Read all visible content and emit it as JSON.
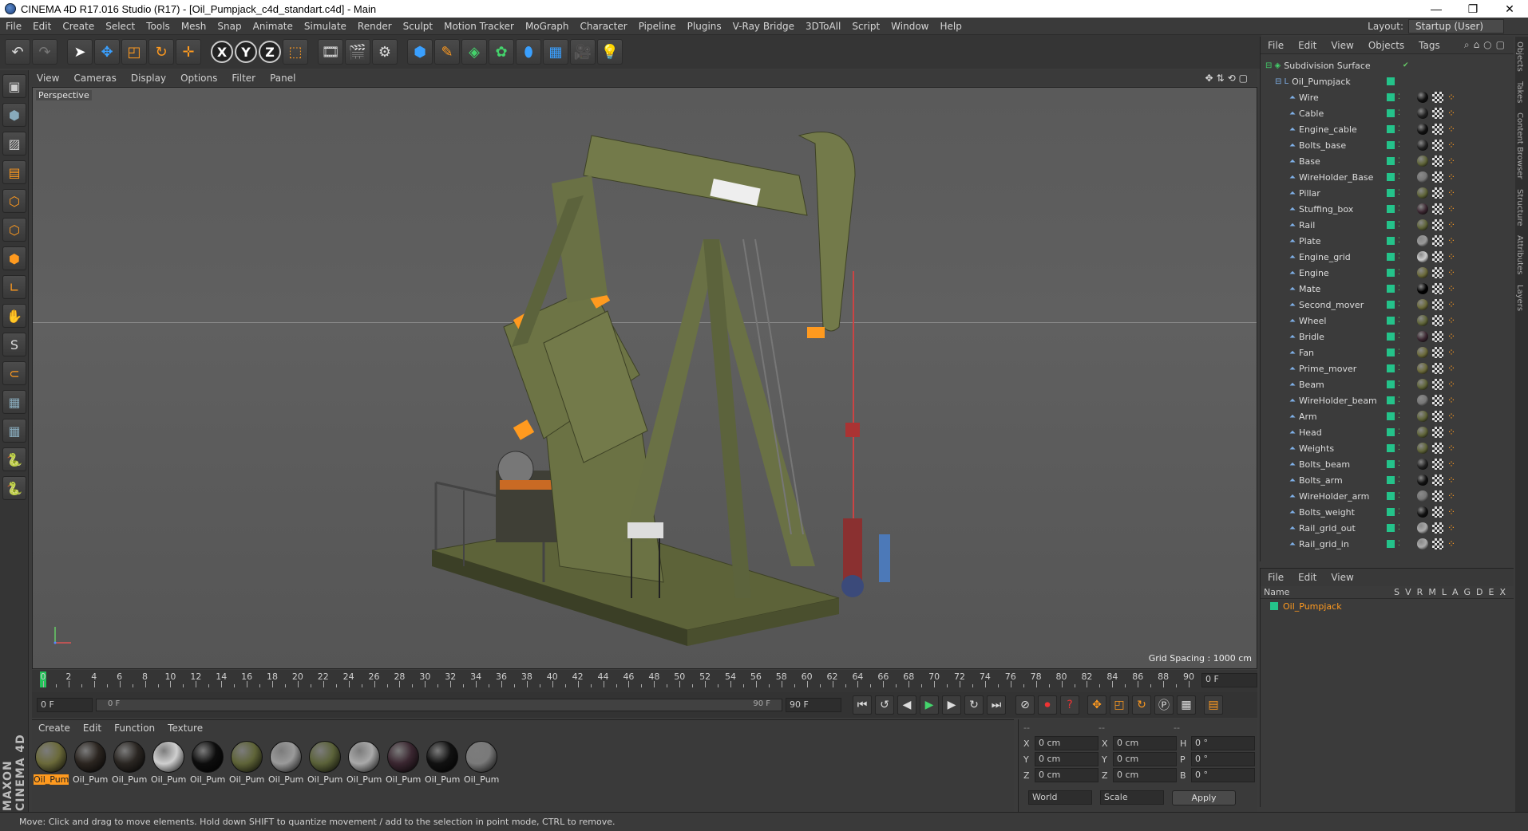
{
  "window": {
    "title": "CINEMA 4D R17.016 Studio (R17) - [Oil_Pumpjack_c4d_standart.c4d] - Main",
    "minimize": "—",
    "restore": "❐",
    "close": "✕"
  },
  "menubar": {
    "items": [
      "File",
      "Edit",
      "Create",
      "Select",
      "Tools",
      "Mesh",
      "Snap",
      "Animate",
      "Simulate",
      "Render",
      "Sculpt",
      "Motion Tracker",
      "MoGraph",
      "Character",
      "Pipeline",
      "Plugins",
      "V-Ray Bridge",
      "3DToAll",
      "Script",
      "Window",
      "Help"
    ],
    "layout_label": "Layout:",
    "layout_value": "Startup (User)"
  },
  "toolbar": {
    "icons": [
      "undo-icon",
      "redo-icon",
      "select-icon",
      "move-icon",
      "scale-icon",
      "rotate-icon",
      "live-select-icon",
      "x-axis-icon",
      "y-axis-icon",
      "z-axis-icon",
      "coordinate-system-icon",
      "render-view-icon",
      "render-picture-icon",
      "render-settings-icon",
      "cube-icon",
      "pen-icon",
      "subdivision-icon",
      "array-icon",
      "deformer-icon",
      "floor-icon",
      "camera-icon",
      "light-icon"
    ],
    "x": "X",
    "y": "Y",
    "z": "Z"
  },
  "viewport": {
    "menu": [
      "View",
      "Cameras",
      "Display",
      "Options",
      "Filter",
      "Panel"
    ],
    "label": "Perspective",
    "grid_spacing": "Grid Spacing : 1000 cm"
  },
  "timeline": {
    "ticks": [
      "0",
      "2",
      "4",
      "6",
      "8",
      "10",
      "12",
      "14",
      "16",
      "18",
      "20",
      "22",
      "24",
      "26",
      "28",
      "30",
      "32",
      "34",
      "36",
      "38",
      "40",
      "42",
      "44",
      "46",
      "48",
      "50",
      "52",
      "54",
      "56",
      "58",
      "60",
      "62",
      "64",
      "66",
      "68",
      "70",
      "72",
      "74",
      "76",
      "78",
      "80",
      "82",
      "84",
      "86",
      "88",
      "90"
    ],
    "current_frame": "0 F",
    "start_field": "0 F",
    "slider_start": "0 F",
    "slider_end": "90 F",
    "end_field": "90 F"
  },
  "materials": {
    "menu": [
      "Create",
      "Edit",
      "Function",
      "Texture"
    ],
    "items": [
      {
        "label": "Oil_Pum",
        "color": "#6b6a3a",
        "selected": true
      },
      {
        "label": "Oil_Pum",
        "color": "#2b2520"
      },
      {
        "label": "Oil_Pum",
        "color": "#2a2622"
      },
      {
        "label": "Oil_Pum",
        "color": "#cfcfcf"
      },
      {
        "label": "Oil_Pum",
        "color": "#0d0d0d"
      },
      {
        "label": "Oil_Pum",
        "color": "#5f6438"
      },
      {
        "label": "Oil_Pum",
        "color": "#9a9a9a"
      },
      {
        "label": "Oil_Pum",
        "color": "#5b6239"
      },
      {
        "label": "Oil_Pum",
        "color": "#a9a9a9"
      },
      {
        "label": "Oil_Pum",
        "color": "#3a2630"
      },
      {
        "label": "Oil_Pum",
        "color": "#111111"
      },
      {
        "label": "Oil_Pum",
        "color": "#7a7a7a"
      }
    ]
  },
  "coords": {
    "header": [
      "--",
      "--",
      "--"
    ],
    "rows": [
      {
        "a": "X",
        "av": "0 cm",
        "b": "X",
        "bv": "0 cm",
        "c": "H",
        "cv": "0 °"
      },
      {
        "a": "Y",
        "av": "0 cm",
        "b": "Y",
        "bv": "0 cm",
        "c": "P",
        "cv": "0 °"
      },
      {
        "a": "Z",
        "av": "0 cm",
        "b": "Z",
        "bv": "0 cm",
        "c": "B",
        "cv": "0 °"
      }
    ],
    "world": "World",
    "scale": "Scale",
    "apply": "Apply"
  },
  "objects": {
    "menu": [
      "File",
      "Edit",
      "View",
      "Objects",
      "Tags"
    ],
    "root": "Subdivision Surface",
    "group": "Oil_Pumpjack",
    "items": [
      {
        "name": "Wire",
        "tag": "#111"
      },
      {
        "name": "Cable",
        "tag": "#222"
      },
      {
        "name": "Engine_cable",
        "tag": "#111"
      },
      {
        "name": "Bolts_base",
        "tag": "#222"
      },
      {
        "name": "Base",
        "tag": "#5f6438"
      },
      {
        "name": "WireHolder_Base",
        "tag": "#777"
      },
      {
        "name": "Pillar",
        "tag": "#5f6438"
      },
      {
        "name": "Stuffing_box",
        "tag": "#3a2630"
      },
      {
        "name": "Rail",
        "tag": "#5f6438"
      },
      {
        "name": "Plate",
        "tag": "#999"
      },
      {
        "name": "Engine_grid",
        "tag": "#ccc"
      },
      {
        "name": "Engine",
        "tag": "#6b6a3a"
      },
      {
        "name": "Mate",
        "tag": "#000"
      },
      {
        "name": "Second_mover",
        "tag": "#6b6a3a"
      },
      {
        "name": "Wheel",
        "tag": "#5f6438"
      },
      {
        "name": "Bridle",
        "tag": "#3a2630"
      },
      {
        "name": "Fan",
        "tag": "#6b6a3a"
      },
      {
        "name": "Prime_mover",
        "tag": "#6b6a3a"
      },
      {
        "name": "Beam",
        "tag": "#5f6438"
      },
      {
        "name": "WireHolder_beam",
        "tag": "#777"
      },
      {
        "name": "Arm",
        "tag": "#5f6438"
      },
      {
        "name": "Head",
        "tag": "#5f6438"
      },
      {
        "name": "Weights",
        "tag": "#5f6438"
      },
      {
        "name": "Bolts_beam",
        "tag": "#222"
      },
      {
        "name": "Bolts_arm",
        "tag": "#111"
      },
      {
        "name": "WireHolder_arm",
        "tag": "#777"
      },
      {
        "name": "Bolts_weight",
        "tag": "#111"
      },
      {
        "name": "Rail_grid_out",
        "tag": "#aaa"
      },
      {
        "name": "Rail_grid_in",
        "tag": "#aaa"
      }
    ]
  },
  "layers": {
    "menu": [
      "File",
      "Edit",
      "View"
    ],
    "name_header": "Name",
    "cols": [
      "S",
      "V",
      "R",
      "M",
      "L",
      "A",
      "G",
      "D",
      "E",
      "X"
    ],
    "row": "Oil_Pumpjack"
  },
  "sidetabs": [
    "Objects",
    "Takes",
    "Content Browser",
    "Structure",
    "Attributes",
    "Layers"
  ],
  "brand": "MAXON CINEMA 4D",
  "status": "Move: Click and drag to move elements. Hold down SHIFT to quantize movement / add to the selection in point mode, CTRL to remove."
}
